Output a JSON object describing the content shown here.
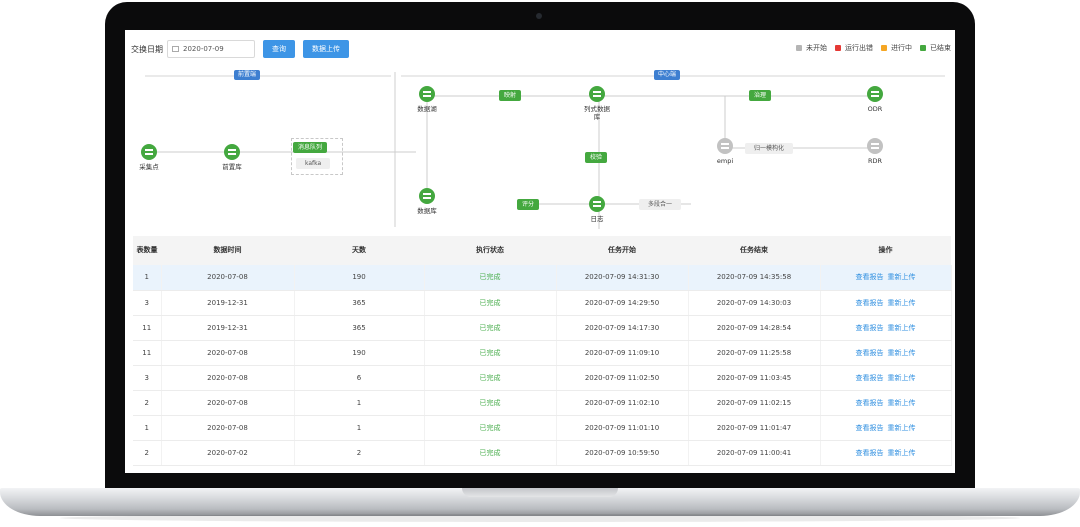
{
  "toolbar": {
    "date_label": "交换日期",
    "date_value": "2020-07-09",
    "query_label": "查询",
    "upload_label": "数据上传"
  },
  "legend": [
    {
      "label": "未开始",
      "color": "#b5b5b5"
    },
    {
      "label": "运行出错",
      "color": "#e53935"
    },
    {
      "label": "进行中",
      "color": "#f5a623"
    },
    {
      "label": "已结束",
      "color": "#44a83f"
    }
  ],
  "diagram": {
    "front_region": "前置端",
    "center_region": "中心端",
    "nodes": {
      "collect": "采集点",
      "front_db": "前置库",
      "data_lake": "数据湖",
      "database": "数据库",
      "column_db": "列式数据库",
      "log": "日志",
      "odr": "ODR",
      "rdr": "RDR",
      "empi": "empi"
    },
    "buttons": {
      "message_queue": "消息队列",
      "kafka": "kafka",
      "mapping": "映射",
      "governance": "治理",
      "validate": "校验",
      "score": "评分",
      "normalize": "归一模构化",
      "merge": "多段合一"
    }
  },
  "table": {
    "headers": [
      "表数量",
      "数据时间",
      "天数",
      "执行状态",
      "任务开始",
      "任务结束",
      "操作"
    ],
    "action_view": "查看报告",
    "action_reupload": "重新上传",
    "rows": [
      {
        "count": "1",
        "date": "2020-07-08",
        "days": "190",
        "status": "已完成",
        "start": "2020-07-09 14:31:30",
        "end": "2020-07-09 14:35:58"
      },
      {
        "count": "3",
        "date": "2019-12-31",
        "days": "365",
        "status": "已完成",
        "start": "2020-07-09 14:29:50",
        "end": "2020-07-09 14:30:03"
      },
      {
        "count": "11",
        "date": "2019-12-31",
        "days": "365",
        "status": "已完成",
        "start": "2020-07-09 14:17:30",
        "end": "2020-07-09 14:28:54"
      },
      {
        "count": "11",
        "date": "2020-07-08",
        "days": "190",
        "status": "已完成",
        "start": "2020-07-09 11:09:10",
        "end": "2020-07-09 11:25:58"
      },
      {
        "count": "3",
        "date": "2020-07-08",
        "days": "6",
        "status": "已完成",
        "start": "2020-07-09 11:02:50",
        "end": "2020-07-09 11:03:45"
      },
      {
        "count": "2",
        "date": "2020-07-08",
        "days": "1",
        "status": "已完成",
        "start": "2020-07-09 11:02:10",
        "end": "2020-07-09 11:02:15"
      },
      {
        "count": "1",
        "date": "2020-07-08",
        "days": "1",
        "status": "已完成",
        "start": "2020-07-09 11:01:10",
        "end": "2020-07-09 11:01:47"
      },
      {
        "count": "2",
        "date": "2020-07-02",
        "days": "2",
        "status": "已完成",
        "start": "2020-07-09 10:59:50",
        "end": "2020-07-09 11:00:41"
      }
    ]
  }
}
